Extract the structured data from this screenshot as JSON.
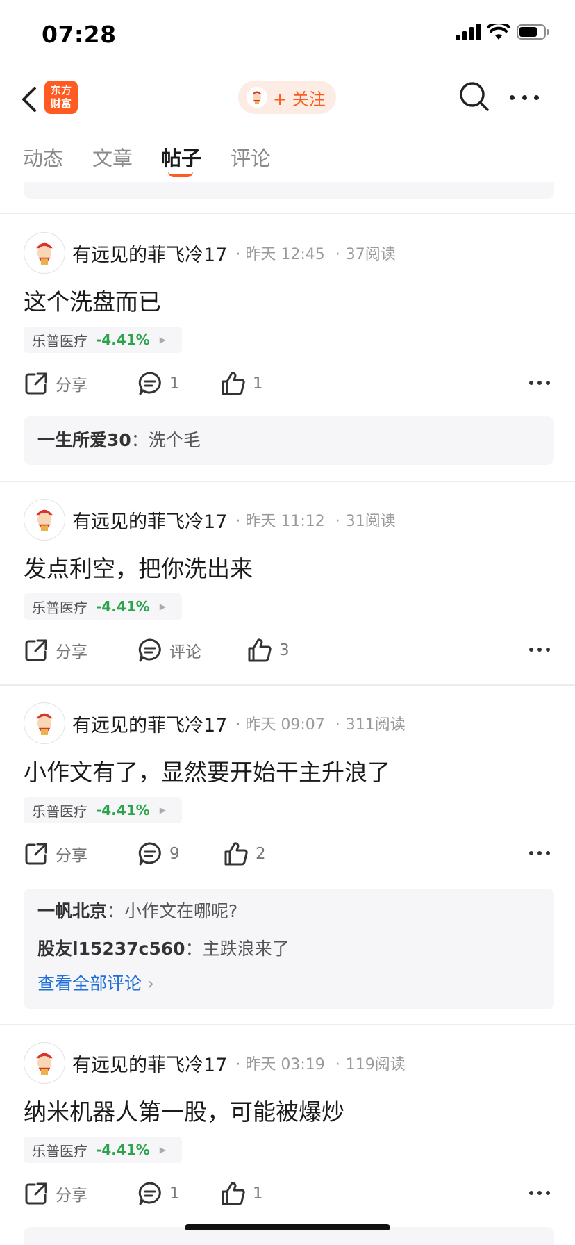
{
  "status_bar": {
    "time": "07:28"
  },
  "nav": {
    "logo_line1": "东方",
    "logo_line2": "财富",
    "follow_label": "+ 关注"
  },
  "tabs": [
    {
      "label": "动态",
      "active": false
    },
    {
      "label": "文章",
      "active": false
    },
    {
      "label": "帖子",
      "active": true
    },
    {
      "label": "评论",
      "active": false
    }
  ],
  "colors": {
    "accent": "#ff5a1f",
    "stock_down": "#2aa34a",
    "link": "#1e6fd9"
  },
  "posts": [
    {
      "author": "有远见的菲飞冷17",
      "time": "昨天 12:45",
      "reads": "37阅读",
      "text": "这个洗盘而已",
      "stock_name": "乐普医疗",
      "stock_change": "-4.41%",
      "share_label": "分享",
      "comment_label": "1",
      "like_label": "1",
      "comments": [
        {
          "user": "一生所爱30",
          "sep": "：",
          "text": "洗个毛"
        }
      ]
    },
    {
      "author": "有远见的菲飞冷17",
      "time": "昨天 11:12",
      "reads": "31阅读",
      "text": "发点利空，把你洗出来",
      "stock_name": "乐普医疗",
      "stock_change": "-4.41%",
      "share_label": "分享",
      "comment_label": "评论",
      "like_label": "3",
      "comments": []
    },
    {
      "author": "有远见的菲飞冷17",
      "time": "昨天 09:07",
      "reads": "311阅读",
      "text": "小作文有了，显然要开始干主升浪了",
      "stock_name": "乐普医疗",
      "stock_change": "-4.41%",
      "share_label": "分享",
      "comment_label": "9",
      "like_label": "2",
      "comments": [
        {
          "user": "一帆北京",
          "sep": "：",
          "text": "小作文在哪呢?"
        },
        {
          "user": "股友l15237c560",
          "sep": "：",
          "text": "主跌浪来了"
        }
      ],
      "view_all": "查看全部评论"
    },
    {
      "author": "有远见的菲飞冷17",
      "time": "昨天 03:19",
      "reads": "119阅读",
      "text": "纳米机器人第一股，可能被爆炒",
      "stock_name": "乐普医疗",
      "stock_change": "-4.41%",
      "share_label": "分享",
      "comment_label": "1",
      "like_label": "1",
      "comments": []
    }
  ],
  "meta_separator": "·",
  "view_all_chevron": "›"
}
